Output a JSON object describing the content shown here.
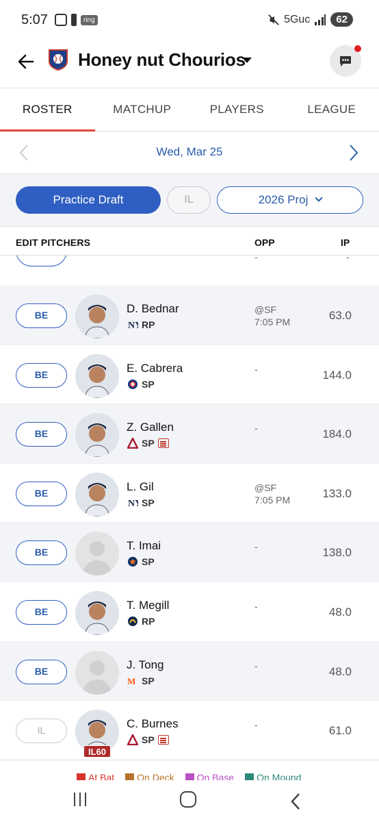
{
  "status_bar": {
    "time": "5:07",
    "ring_label": "ring",
    "network": "5Guc",
    "battery": "62"
  },
  "header": {
    "team_name": "Honey nut Chourios"
  },
  "tabs": [
    {
      "label": "ROSTER",
      "active": true
    },
    {
      "label": "MATCHUP",
      "active": false
    },
    {
      "label": "PLAYERS",
      "active": false
    },
    {
      "label": "LEAGUE",
      "active": false
    }
  ],
  "date": {
    "label": "Wed, Mar 25"
  },
  "filters": {
    "practice_draft": "Practice Draft",
    "il": "IL",
    "projection": "2026 Proj"
  },
  "columns": {
    "title": "EDIT PITCHERS",
    "opp": "OPP",
    "ip": "IP"
  },
  "partial_row": {
    "opp": "-",
    "ip": "-"
  },
  "players": [
    {
      "slot": "BE",
      "name": "D. Bednar",
      "team_icon": "yankees-logo-icon",
      "pos": "RP",
      "news": false,
      "opp_line1": "@SF",
      "opp_line2": "7:05 PM",
      "ip": "63.0",
      "photo": true,
      "il_badge": ""
    },
    {
      "slot": "BE",
      "name": "E. Cabrera",
      "team_icon": "cubs-logo-icon",
      "pos": "SP",
      "news": false,
      "opp_line1": "-",
      "opp_line2": "",
      "ip": "144.0",
      "photo": true,
      "il_badge": ""
    },
    {
      "slot": "BE",
      "name": "Z. Gallen",
      "team_icon": "diamondbacks-logo-icon",
      "pos": "SP",
      "news": true,
      "opp_line1": "-",
      "opp_line2": "",
      "ip": "184.0",
      "photo": true,
      "il_badge": ""
    },
    {
      "slot": "BE",
      "name": "L. Gil",
      "team_icon": "yankees-logo-icon",
      "pos": "SP",
      "news": false,
      "opp_line1": "@SF",
      "opp_line2": "7:05 PM",
      "ip": "133.0",
      "photo": true,
      "il_badge": ""
    },
    {
      "slot": "BE",
      "name": "T. Imai",
      "team_icon": "astros-logo-icon",
      "pos": "SP",
      "news": false,
      "opp_line1": "-",
      "opp_line2": "",
      "ip": "138.0",
      "photo": false,
      "il_badge": ""
    },
    {
      "slot": "BE",
      "name": "T. Megill",
      "team_icon": "brewers-logo-icon",
      "pos": "RP",
      "news": false,
      "opp_line1": "-",
      "opp_line2": "",
      "ip": "48.0",
      "photo": true,
      "il_badge": ""
    },
    {
      "slot": "BE",
      "name": "J. Tong",
      "team_icon": "mets-logo-icon",
      "pos": "SP",
      "news": false,
      "opp_line1": "-",
      "opp_line2": "",
      "ip": "48.0",
      "photo": false,
      "il_badge": ""
    },
    {
      "slot": "IL",
      "name": "C. Burnes",
      "team_icon": "diamondbacks-logo-icon",
      "pos": "SP",
      "news": true,
      "opp_line1": "-",
      "opp_line2": "",
      "ip": "61.0",
      "photo": true,
      "il_badge": "IL60"
    }
  ],
  "legend": [
    {
      "label": "At Bat",
      "color": "#d9342b"
    },
    {
      "label": "On Deck",
      "color": "#b5742a"
    },
    {
      "label": "On Base",
      "color": "#b84fc2"
    },
    {
      "label": "On Mound",
      "color": "#2e8a7a"
    }
  ],
  "colors": {
    "accent_blue": "#2f5fc3",
    "tab_underline": "#e0473a",
    "alt_row": "#f3f4f8"
  }
}
